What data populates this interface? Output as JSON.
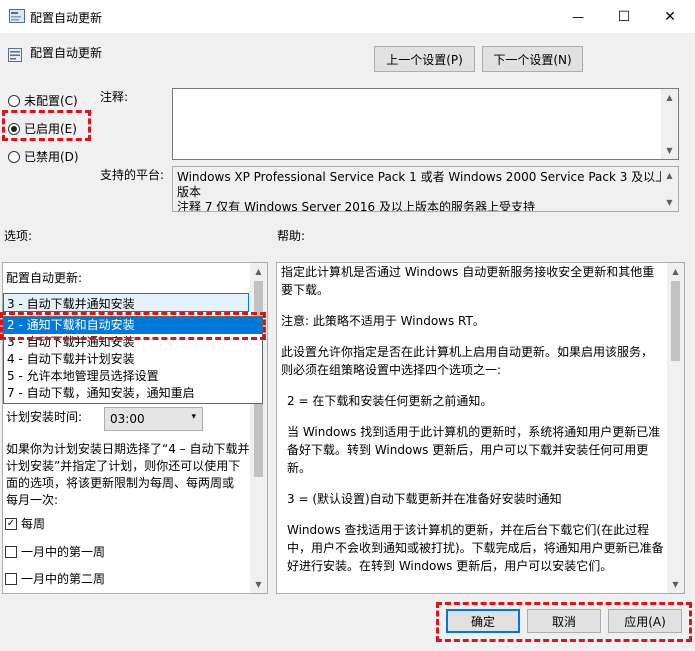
{
  "window": {
    "title": "配置自动更新",
    "minimize_glyph": "—",
    "maximize_glyph": "☐",
    "close_glyph": "✕"
  },
  "header": {
    "title": "配置自动更新",
    "prev_button": "上一个设置(P)",
    "next_button": "下一个设置(N)"
  },
  "state": {
    "options": [
      {
        "label": "未配置(C)",
        "checked": false
      },
      {
        "label": "已启用(E)",
        "checked": true
      },
      {
        "label": "已禁用(D)",
        "checked": false
      }
    ]
  },
  "comment": {
    "label": "注释:",
    "value": ""
  },
  "platform": {
    "label": "支持的平台:",
    "lines": [
      "Windows XP Professional Service Pack 1 或者 Windows 2000 Service Pack 3 及以上",
      "版本",
      "注释 7 仅有 Windows Server 2016 及以上版本的服务器上受支持"
    ]
  },
  "options_label": "选项:",
  "help_label": "帮助:",
  "options_panel": {
    "configure_label": "配置自动更新:",
    "combo_value": "3 - 自动下载并通知安装",
    "dropdown_items": [
      "3 - 自动下载并通知安装",
      "2 - 通知下载和自动安装",
      "3 - 自动下载并通知安装",
      "4 - 自动下载并计划安装",
      "5 - 允许本地管理员选择设置",
      "7 - 自动下载，通知安装，通知重启"
    ],
    "selected_index": 1,
    "schedule_label": "计划安装时间:",
    "schedule_value": "03:00",
    "desc_lines": [
      "如果你为计划安装日期选择了“4 – 自动下载并",
      "计划安装”并指定了计划，则你还可以使用下",
      "面的选项，将该更新限制为每周、每两周或",
      "每月一次:"
    ],
    "checkboxes": [
      {
        "label": "每周",
        "checked": true
      },
      {
        "label": "一月中的第一周",
        "checked": false
      },
      {
        "label": "一月中的第二周",
        "checked": false
      }
    ]
  },
  "help_text": [
    "指定此计算机是否通过 Windows 自动更新服务接收安全更新和其他重要下载。",
    "注意: 此策略不适用于 Windows RT。",
    "此设置允许你指定是否在此计算机上启用自动更新。如果启用该服务，则必须在组策略设置中选择四个选项之一:",
    "2 = 在下载和安装任何更新之前通知。",
    "当 Windows 找到适用于此计算机的更新时，系统将通知用户更新已准备好下载。转到 Windows 更新后，用户可以下载并安装任何可用更新。",
    "3 = (默认设置)自动下载更新并在准备好安装时通知",
    "Windows 查找适用于该计算机的更新，并在后台下载它们(在此过程中，用户不会收到通知或被打扰)。下载完成后，将通知用户更新已准备好进行安装。在转到 Windows 更新后，用户可以安装它们。"
  ],
  "footer": {
    "ok": "确定",
    "cancel": "取消",
    "apply": "应用(A)"
  },
  "colors": {
    "highlight": "#0078d7",
    "annotation": "#d5161c"
  }
}
